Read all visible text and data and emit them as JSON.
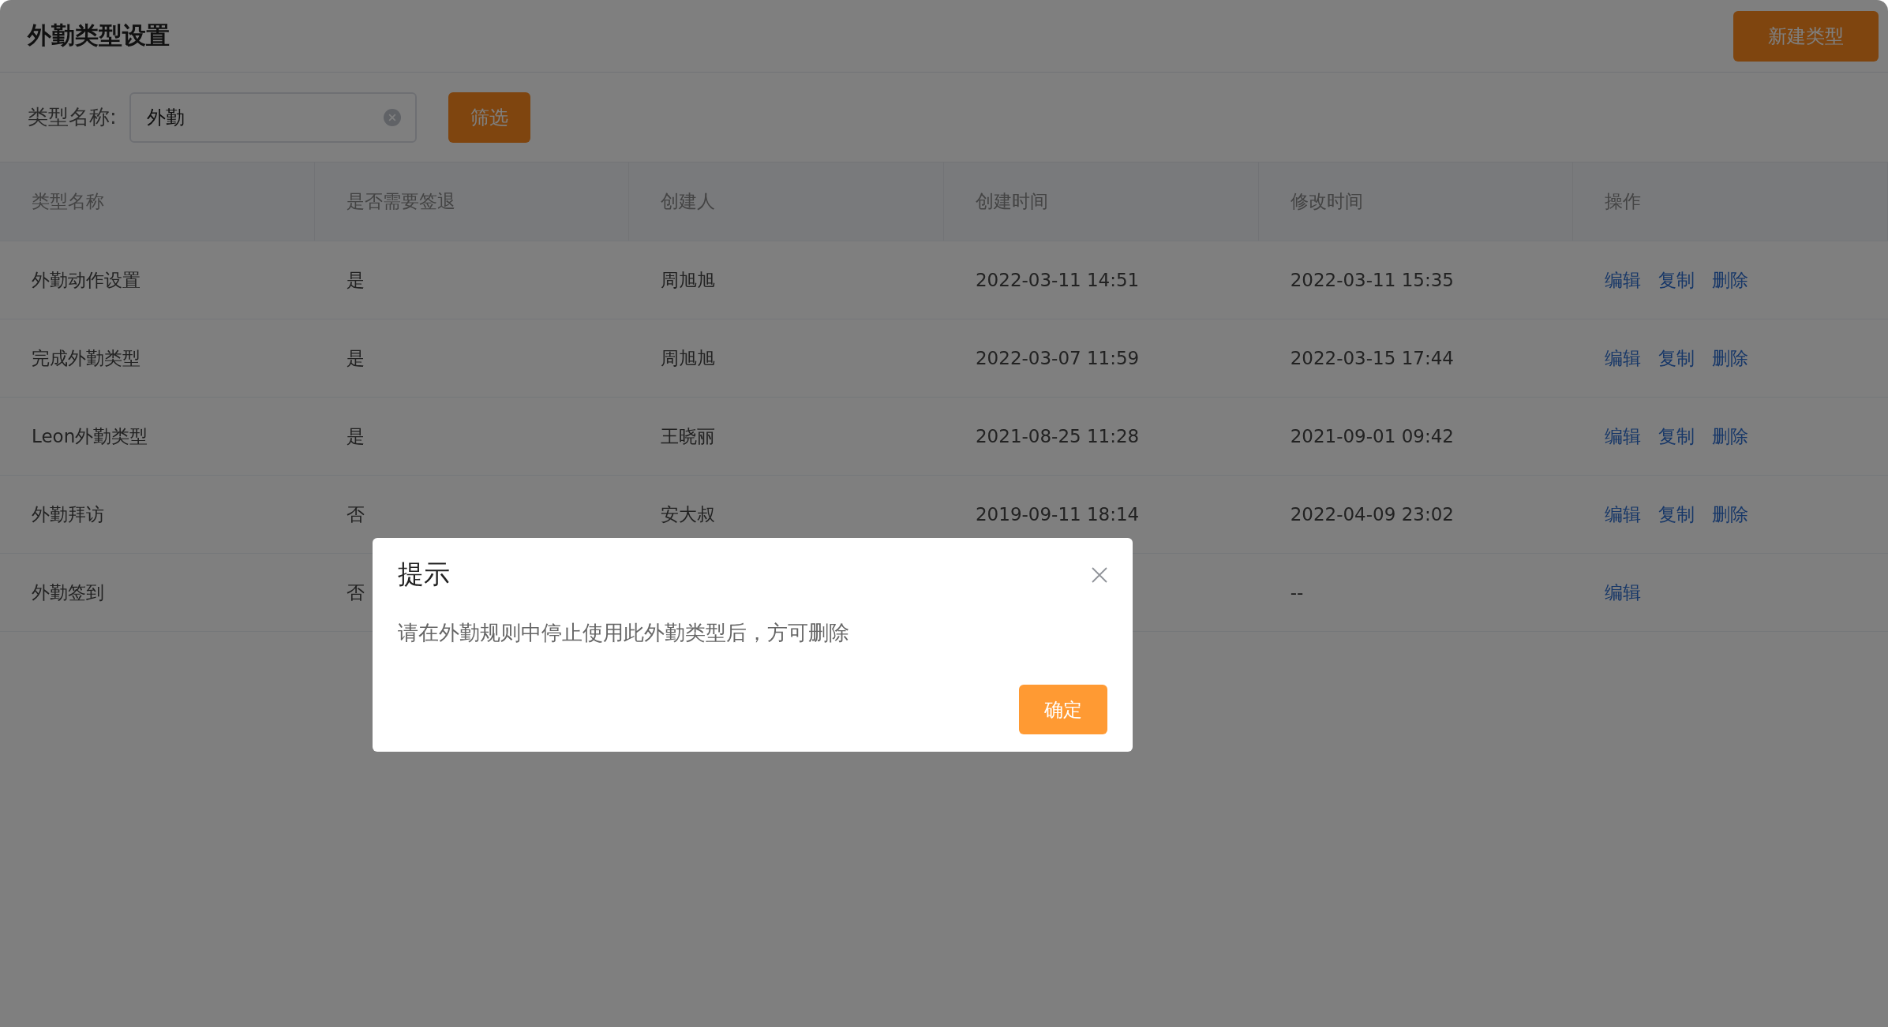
{
  "page": {
    "title": "外勤类型设置",
    "new_button": "新建类型"
  },
  "filter": {
    "label": "类型名称:",
    "value": "外勤",
    "button": "筛选"
  },
  "table": {
    "columns": [
      "类型名称",
      "是否需要签退",
      "创建人",
      "创建时间",
      "修改时间",
      "操作"
    ],
    "rows": [
      {
        "name": "外勤动作设置",
        "needs_checkout": "是",
        "creator": "周旭旭",
        "created": "2022-03-11 14:51",
        "modified": "2022-03-11 15:35",
        "actions": [
          "编辑",
          "复制",
          "删除"
        ]
      },
      {
        "name": "完成外勤类型",
        "needs_checkout": "是",
        "creator": "周旭旭",
        "created": "2022-03-07 11:59",
        "modified": "2022-03-15 17:44",
        "actions": [
          "编辑",
          "复制",
          "删除"
        ]
      },
      {
        "name": "Leon外勤类型",
        "needs_checkout": "是",
        "creator": "王晓丽",
        "created": "2021-08-25 11:28",
        "modified": "2021-09-01 09:42",
        "actions": [
          "编辑",
          "复制",
          "删除"
        ]
      },
      {
        "name": "外勤拜访",
        "needs_checkout": "否",
        "creator": "安大叔",
        "created": "2019-09-11 18:14",
        "modified": "2022-04-09 23:02",
        "actions": [
          "编辑",
          "复制",
          "删除"
        ]
      },
      {
        "name": "外勤签到",
        "needs_checkout": "否",
        "modified": "--",
        "actions": [
          "编辑"
        ]
      }
    ]
  },
  "dialog": {
    "title": "提示",
    "message": "请在外勤规则中停止使用此外勤类型后，方可删除",
    "confirm": "确定"
  }
}
